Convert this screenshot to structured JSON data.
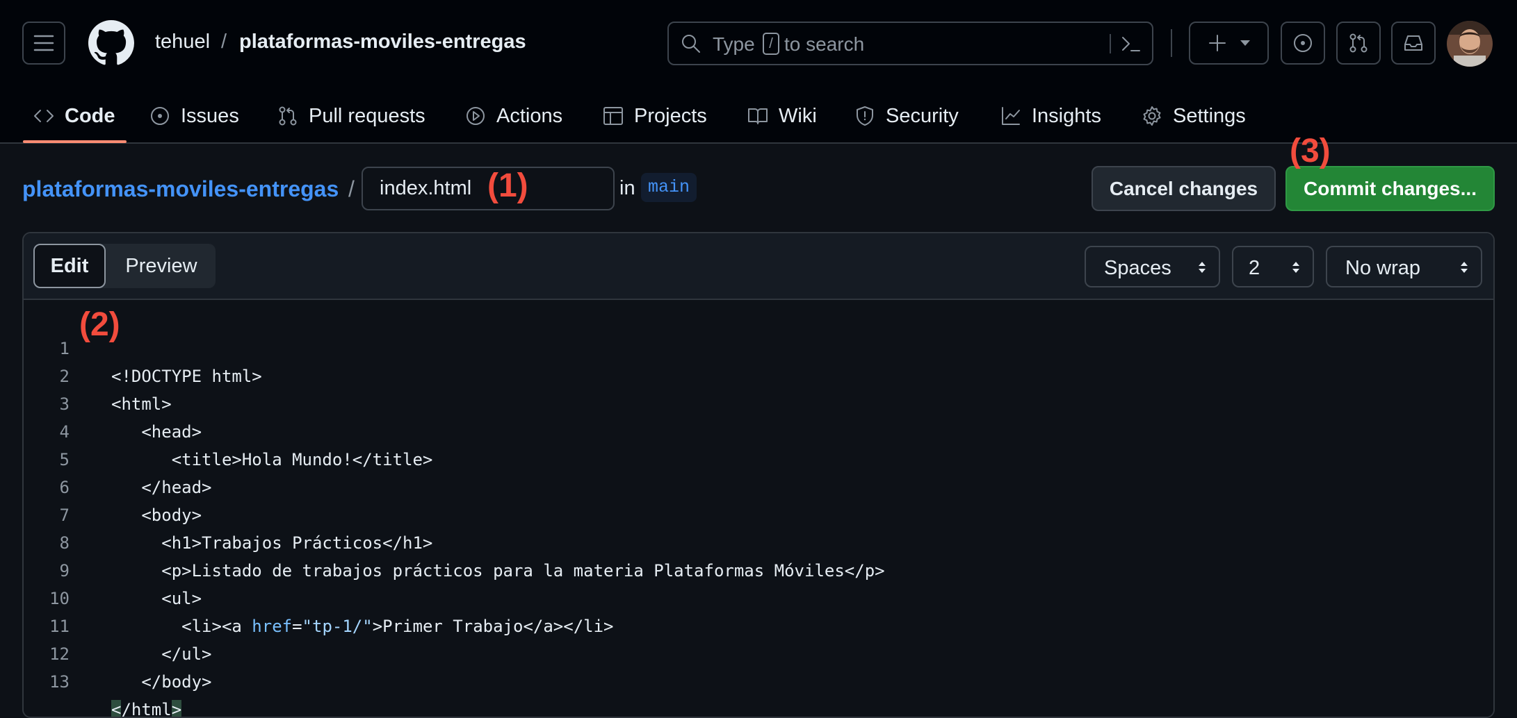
{
  "header": {
    "repo_owner": "tehuel",
    "repo_separator": "/",
    "repo_name": "plataformas-moviles-entregas",
    "search": {
      "placeholder_start": "Type",
      "slash_key": "/",
      "placeholder_end": "to search"
    },
    "icons": [
      "hamburger-icon",
      "github-logo",
      "search-icon",
      "command-palette-icon",
      "plus-icon",
      "triangle-down-icon",
      "issue-opened-icon",
      "git-pull-request-icon",
      "inbox-icon"
    ]
  },
  "nav": {
    "tabs": [
      {
        "label": "Code",
        "icon": "code-icon"
      },
      {
        "label": "Issues",
        "icon": "issue-opened-icon"
      },
      {
        "label": "Pull requests",
        "icon": "git-pull-request-icon"
      },
      {
        "label": "Actions",
        "icon": "play-icon"
      },
      {
        "label": "Projects",
        "icon": "table-icon"
      },
      {
        "label": "Wiki",
        "icon": "book-icon"
      },
      {
        "label": "Security",
        "icon": "shield-icon"
      },
      {
        "label": "Insights",
        "icon": "graph-icon"
      },
      {
        "label": "Settings",
        "icon": "gear-icon"
      }
    ],
    "active": "Code",
    "active_underline_color": "#fd8c73"
  },
  "file_header": {
    "repo_link": "plataformas-moviles-entregas",
    "separator": "/",
    "filename": "index.html",
    "in_label": "in",
    "branch": "main",
    "cancel_label": "Cancel changes",
    "commit_label": "Commit changes..."
  },
  "annotations": {
    "a1": "(1)",
    "a2": "(2)",
    "a3": "(3)",
    "color": "#f24c3d"
  },
  "editor": {
    "tabs": {
      "edit": "Edit",
      "preview": "Preview"
    },
    "indent_mode": "Spaces",
    "indent_size": "2",
    "wrap_mode": "No wrap"
  },
  "code": {
    "lines": [
      {
        "n": "1",
        "text": "<!DOCTYPE html>"
      },
      {
        "n": "2",
        "text": "<html>"
      },
      {
        "n": "3",
        "text": "   <head>"
      },
      {
        "n": "4",
        "text": "      <title>Hola Mundo!</title>"
      },
      {
        "n": "5",
        "text": "   </head>"
      },
      {
        "n": "6",
        "text": "   <body>"
      },
      {
        "n": "7",
        "text": "     <h1>Trabajos Prácticos</h1>"
      },
      {
        "n": "8",
        "text": "     <p>Listado de trabajos prácticos para la materia Plataformas Móviles</p>"
      },
      {
        "n": "9",
        "text": "     <ul>"
      },
      {
        "n": "10",
        "pre": "       <li><a ",
        "attr": "href",
        "eq": "=",
        "str": "\"tp-1/\"",
        "post": ">Primer Trabajo</a></li>"
      },
      {
        "n": "11",
        "text": "     </ul>"
      },
      {
        "n": "12",
        "text": "   </body>"
      },
      {
        "n": "13",
        "hl1": "<",
        "mid": "/html",
        "hl2": ">"
      }
    ]
  },
  "colors": {
    "background": "#0d1117",
    "header_bg": "#010409",
    "link": "#4493f8",
    "commit_green": "#238636",
    "code_attr": "#79c0ff",
    "code_string": "#a5d6ff"
  }
}
